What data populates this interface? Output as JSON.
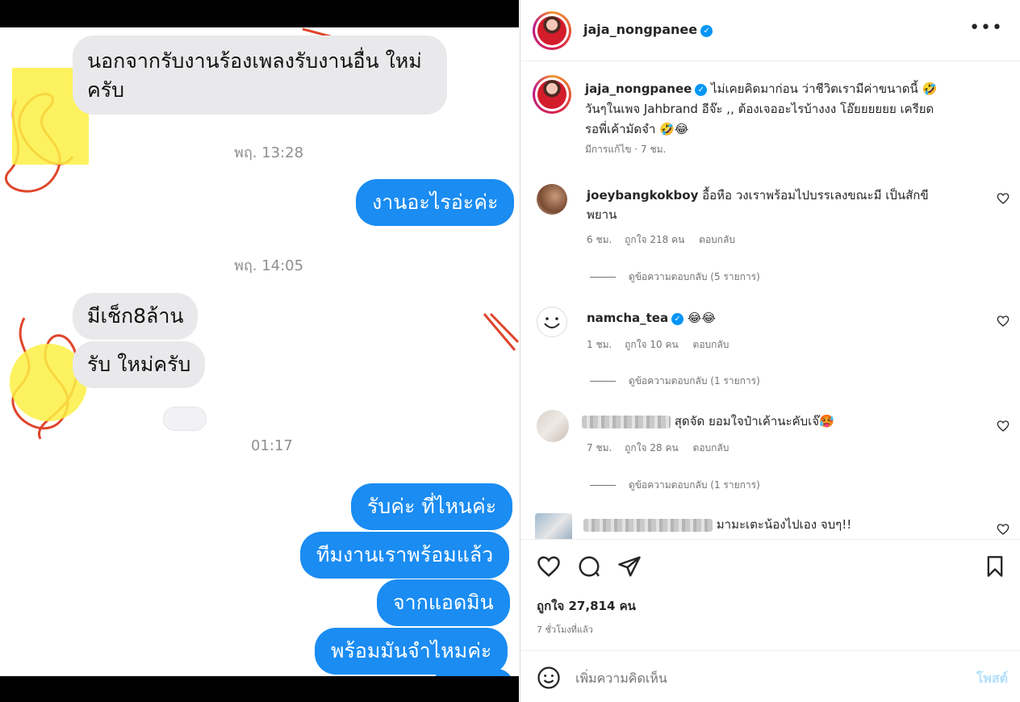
{
  "chat": {
    "messages": [
      {
        "id": "m1",
        "text": "นอกจากรับงานร้องเพลงรับงานอื่น ใหม่"
      },
      {
        "id": "m2",
        "text": "ครับ"
      },
      {
        "id": "t1",
        "text": "พฤ. 13:28"
      },
      {
        "id": "m3",
        "text": "งานอะไรอ่ะค่ะ"
      },
      {
        "id": "t2",
        "text": "พฤ. 14:05"
      },
      {
        "id": "m4",
        "text": "มีเช็ก8ล้าน"
      },
      {
        "id": "m5",
        "text": "รับ ใหม่ครับ"
      },
      {
        "id": "t3",
        "text": "01:17"
      },
      {
        "id": "m6",
        "text": "รับค่ะ ที่ไหนค่ะ"
      },
      {
        "id": "m7",
        "text": "ทีมงานเราพร้อมแล้ว"
      },
      {
        "id": "m8",
        "text": "จากแอดมิน"
      },
      {
        "id": "m9",
        "text": "พร้อมมันจำไหมค่ะ"
      }
    ]
  },
  "header": {
    "username": "jaja_nongpanee",
    "more_icon": "more-horizontal-icon",
    "verified_icon": "verified-badge-icon"
  },
  "caption": {
    "username": "jaja_nongpanee",
    "line1": "ไม่เคยคิดมาก่อน ว่าชีวิตเรามีค่าขนาดนี้ 🤣",
    "line2": "วันๆในเพจ Jahbrand อีจ๊ะ ,, ต้องเจออะไรบ้างงง โอ๊ยยยยยย เครียด",
    "line3": "รอพี่เค้ามัดจำ 🤣😂",
    "meta": "มีการแก้ไข · 7 ชม."
  },
  "comments": [
    {
      "username": "joeybangkokboy",
      "text_line1": "อื้อหือ วงเราพร้อมไปบรรเลงขณะมี เป็นสักขี",
      "text_line2": "พยาน",
      "time": "6 ชม.",
      "likes": "ถูกใจ 218 คน",
      "reply": "ตอบกลับ",
      "view_replies": "ดูข้อความตอบกลับ (5 รายการ)"
    },
    {
      "username": "namcha_tea",
      "text_line1": "😂😂",
      "time": "1 ชม.",
      "likes": "ถูกใจ 10 คน",
      "reply": "ตอบกลับ",
      "view_replies": "ดูข้อความตอบกลับ (1 รายการ)"
    },
    {
      "username": "",
      "text_line1": "สุดจัด ยอมใจป๋าเค้านะคับเจ๊🥵",
      "time": "7 ชม.",
      "likes": "ถูกใจ 28 คน",
      "reply": "ตอบกลับ",
      "view_replies": "ดูข้อความตอบกลับ (1 รายการ)"
    },
    {
      "username": "",
      "text_line1": "มามะเตะน้องไปเอง จบๆ!!"
    }
  ],
  "actions": {
    "like_icon": "heart-icon",
    "comment_icon": "comment-icon",
    "share_icon": "send-icon",
    "save_icon": "bookmark-icon",
    "likes_count": "ถูกใจ 27,814 คน",
    "posted_time": "7 ชั่วโมงที่แล้ว"
  },
  "composer": {
    "emoji_icon": "emoji-icon",
    "placeholder": "เพิ่มความคิดเห็น",
    "post_label": "โพสต์"
  },
  "colors": {
    "accent": "#0095f6",
    "chat_out": "#1a8cf2",
    "chat_in": "#e9e9eb"
  }
}
